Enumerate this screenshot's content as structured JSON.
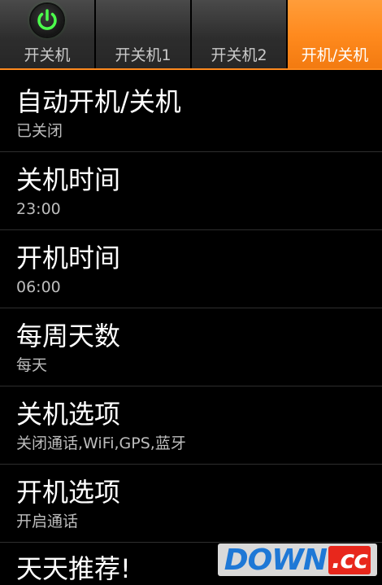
{
  "tabs": [
    {
      "label": "开关机",
      "icon": "power-icon",
      "active": false
    },
    {
      "label": "开关机1",
      "active": false
    },
    {
      "label": "开关机2",
      "active": false
    },
    {
      "label": "开机/关机",
      "active": true
    }
  ],
  "settings": [
    {
      "title": "自动开机/关机",
      "summary": "已关闭"
    },
    {
      "title": "关机时间",
      "summary": "23:00"
    },
    {
      "title": "开机时间",
      "summary": "06:00"
    },
    {
      "title": "每周天数",
      "summary": "每天"
    },
    {
      "title": "关机选项",
      "summary": "关闭通话,WiFi,GPS,蓝牙"
    },
    {
      "title": "开机选项",
      "summary": "开启通话"
    }
  ],
  "recommend_title": "天天推荐!",
  "watermark": {
    "main": "DOWN",
    "tld": ".cc"
  },
  "colors": {
    "accent": "#ff8a1e",
    "background": "#000000",
    "icon_glow": "#4cff4c"
  }
}
